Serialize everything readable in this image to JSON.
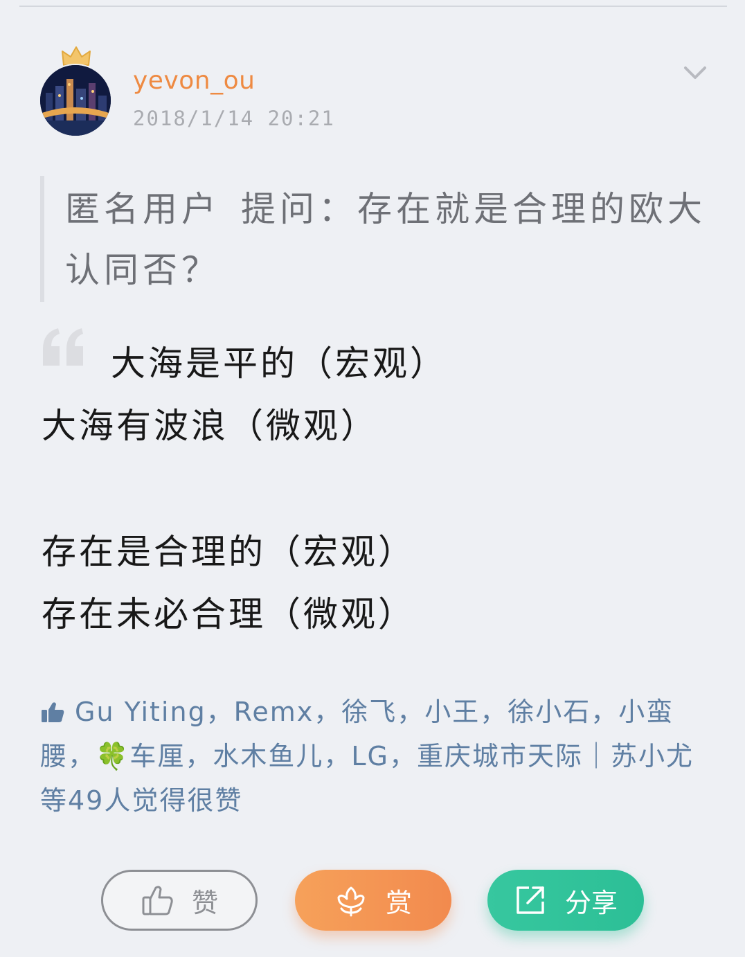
{
  "post": {
    "author": "yevon_ou",
    "timestamp": "2018/1/14 20:21",
    "question": {
      "asker": "匿名用户",
      "text": "提问：存在就是合理的欧大认同否？"
    },
    "answer_lines": [
      "大海是平的（宏观）",
      "大海有波浪（微观）",
      "",
      "存在是合理的（宏观）",
      "存在未必合理（微观）"
    ],
    "likes": {
      "text_before_clover": "Gu Yiting，Remx，徐飞，小王，徐小石，小蛮腰，",
      "clover_emoji": "🍀",
      "text_after_clover": "车厘，水木鱼儿，LG，重庆城市天际｜苏小尤等49人觉得很赞"
    }
  },
  "actions": {
    "like_label": "赞",
    "reward_label": "赏",
    "share_label": "分享"
  },
  "icons": {
    "crown": "crown-icon",
    "chevron": "chevron-down-icon",
    "quote": "quote-icon",
    "thumb": "thumbs-up-icon",
    "flower": "flower-icon",
    "share": "share-icon"
  },
  "colors": {
    "username": "#ee8a42",
    "likes_text": "#5f7fa3",
    "reward_button": "#f28a4e",
    "share_button": "#2cbf96"
  }
}
